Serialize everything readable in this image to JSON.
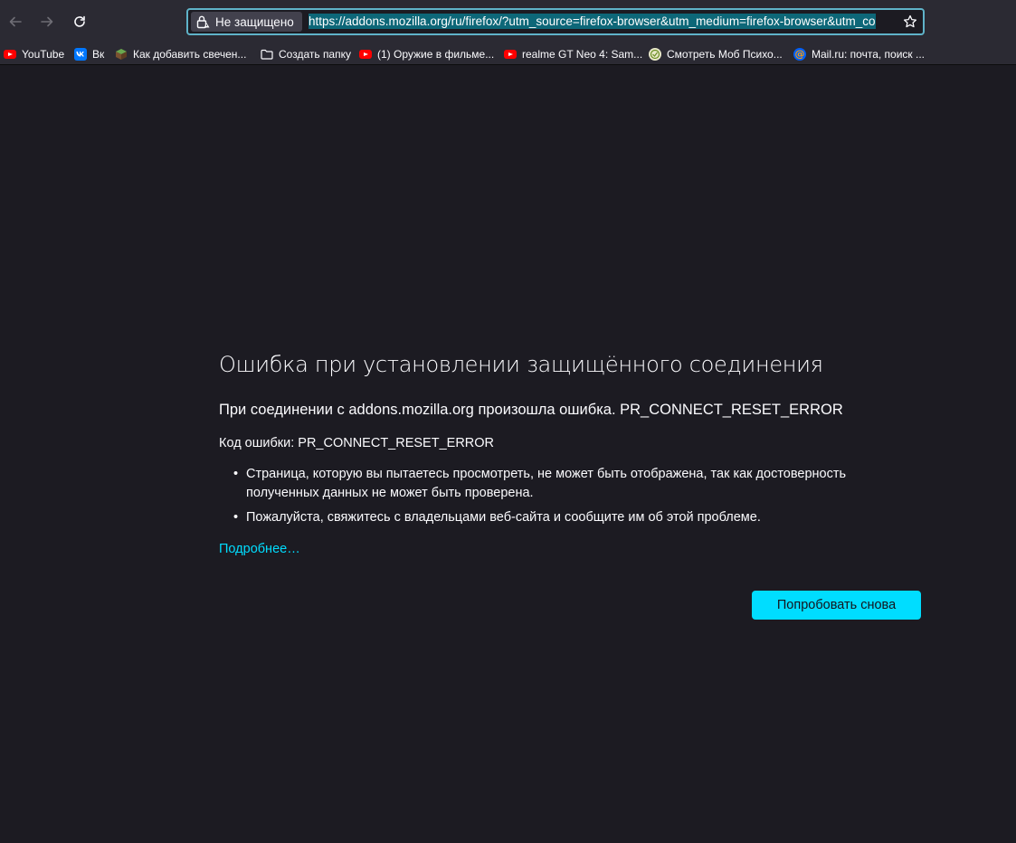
{
  "toolbar": {
    "identity_label": "Не защищено",
    "url": "https://addons.mozilla.org/ru/firefox/?utm_source=firefox-browser&utm_medium=firefox-browser&utm_co"
  },
  "bookmarks": [
    {
      "label": "YouTube",
      "icon": "youtube-icon"
    },
    {
      "label": "Вк",
      "icon": "vk-icon"
    },
    {
      "label": "Как добавить свечен...",
      "icon": "minecraft-icon"
    },
    {
      "label": "Создать папку",
      "icon": "folder-icon"
    },
    {
      "label": "(1) Оружие в фильме...",
      "icon": "youtube-icon"
    },
    {
      "label": "realme GT Neo 4: Sam...",
      "icon": "youtube-icon"
    },
    {
      "label": "Смотреть Моб Психо...",
      "icon": "anime-site-icon"
    },
    {
      "label": "Mail.ru: почта, поиск ...",
      "icon": "mailru-icon"
    }
  ],
  "error": {
    "title": "Ошибка при установлении защищённого соединения",
    "short_desc": "При соединении с addons.mozilla.org произошла ошибка. PR_CONNECT_RESET_ERROR",
    "code_line": "Код ошибки: PR_CONNECT_RESET_ERROR",
    "bullets": [
      "Страница, которую вы пытаетесь просмотреть, не может быть отображена, так как достоверность полученных данных не может быть проверена.",
      "Пожалуйста, свяжитесь с владельцами веб-сайта и сообщите им об этой проблеме."
    ],
    "learn_more": "Подробнее…",
    "try_again": "Попробовать снова"
  },
  "colors": {
    "page_bg": "#1c1b22",
    "toolbar_bg": "#2b2a33",
    "accent": "#00ddff",
    "url_highlight": "#0d6778"
  }
}
